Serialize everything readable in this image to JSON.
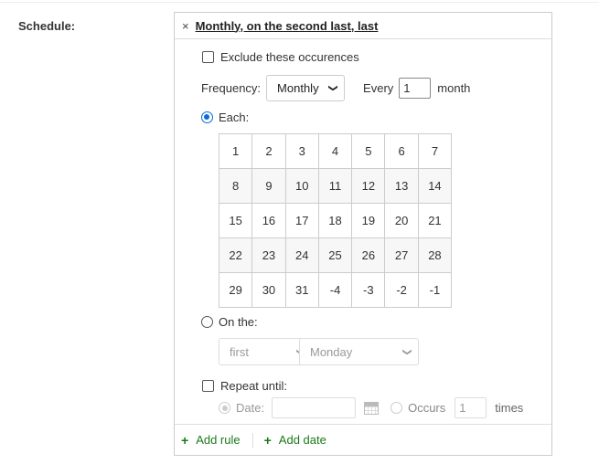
{
  "field": {
    "label": "Schedule:"
  },
  "rule": {
    "remove_icon": "×",
    "title": "Monthly, on the second last, last",
    "exclude_label": "Exclude these occurences",
    "exclude_checked": false,
    "frequency": {
      "label": "Frequency:",
      "value": "Monthly",
      "every_label": "Every",
      "every_value": "1",
      "unit": "month"
    },
    "mode_each": {
      "label": "Each:",
      "selected": true
    },
    "days": [
      [
        "1",
        "2",
        "3",
        "4",
        "5",
        "6",
        "7"
      ],
      [
        "8",
        "9",
        "10",
        "11",
        "12",
        "13",
        "14"
      ],
      [
        "15",
        "16",
        "17",
        "18",
        "19",
        "20",
        "21"
      ],
      [
        "22",
        "23",
        "24",
        "25",
        "26",
        "27",
        "28"
      ],
      [
        "29",
        "30",
        "31",
        "-4",
        "-3",
        "-2",
        "-1"
      ]
    ],
    "mode_on_the": {
      "label": "On the:",
      "selected": false,
      "position": "first",
      "weekday": "Monday"
    },
    "repeat_until": {
      "label": "Repeat until:",
      "checked": false,
      "date_label": "Date:",
      "date_value": "",
      "date_selected": true,
      "occurs_label": "Occurs",
      "occurs_value": "1",
      "times_label": "times"
    }
  },
  "footer": {
    "add_rule": "Add rule",
    "add_date": "Add date",
    "plus_icon": "+"
  },
  "colors": {
    "accent": "#0b6bdc",
    "link_green": "#1a7a1a",
    "border": "#cccccc"
  }
}
